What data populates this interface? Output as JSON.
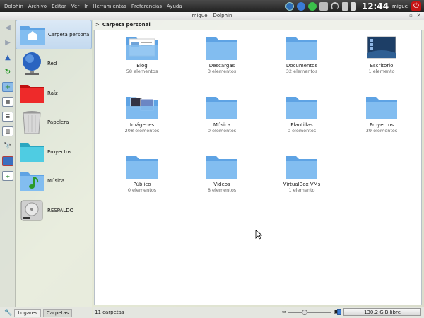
{
  "panel": {
    "menu": [
      "Dolphin",
      "Archivo",
      "Editar",
      "Ver",
      "Ir",
      "Herramientas",
      "Preferencias",
      "Ayuda"
    ],
    "clock": "12:44",
    "user": "migue"
  },
  "window": {
    "title": "migue – Dolphin"
  },
  "breadcrumb": {
    "label": "Carpeta personal"
  },
  "places": [
    {
      "label": "Carpeta personal",
      "icon": "home-folder-icon"
    },
    {
      "label": "Red",
      "icon": "network-globe-icon"
    },
    {
      "label": "Raíz",
      "icon": "root-folder-icon"
    },
    {
      "label": "Papelera",
      "icon": "trash-icon"
    },
    {
      "label": "Proyectos",
      "icon": "projects-folder-icon"
    },
    {
      "label": "Música",
      "icon": "music-folder-icon"
    },
    {
      "label": "RESPALDO",
      "icon": "hard-drive-icon"
    }
  ],
  "panel_tabs": {
    "lugares": "Lugares",
    "carpetas": "Carpetas"
  },
  "files": [
    {
      "name": "Blog",
      "count": "58 elementos",
      "icon": "blog-folder-icon"
    },
    {
      "name": "Descargas",
      "count": "3 elementos",
      "icon": "folder-icon"
    },
    {
      "name": "Documentos",
      "count": "32 elementos",
      "icon": "folder-icon"
    },
    {
      "name": "Escritorio",
      "count": "1 elemento",
      "icon": "desktop-folder-icon"
    },
    {
      "name": "Imágenes",
      "count": "208 elementos",
      "icon": "pictures-folder-icon"
    },
    {
      "name": "Música",
      "count": "0 elementos",
      "icon": "folder-icon"
    },
    {
      "name": "Plantillas",
      "count": "0 elementos",
      "icon": "folder-icon"
    },
    {
      "name": "Proyectos",
      "count": "39 elementos",
      "icon": "folder-icon"
    },
    {
      "name": "Público",
      "count": "0 elementos",
      "icon": "folder-icon"
    },
    {
      "name": "Vídeos",
      "count": "8 elementos",
      "icon": "folder-icon"
    },
    {
      "name": "VirtualBox VMs",
      "count": "1 elemento",
      "icon": "folder-icon"
    }
  ],
  "status": {
    "summary": "11 carpetas",
    "free_space": "130,2 GiB libre"
  },
  "colors": {
    "folder": "#7fb2e8",
    "accent": "#9fbbda"
  }
}
